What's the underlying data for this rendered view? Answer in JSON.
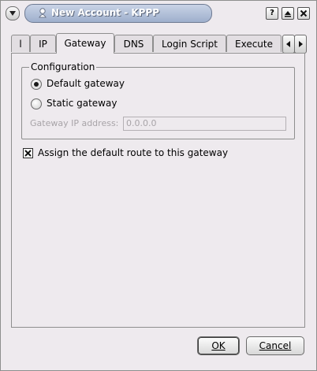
{
  "window": {
    "title": "New Account - KPPP",
    "buttons": {
      "help": "?",
      "maximize": "▲",
      "close": "✕"
    }
  },
  "tabs": [
    {
      "label": "l",
      "active": false
    },
    {
      "label": "IP",
      "active": false
    },
    {
      "label": "Gateway",
      "active": true
    },
    {
      "label": "DNS",
      "active": false
    },
    {
      "label": "Login Script",
      "active": false
    },
    {
      "label": "Execute",
      "active": false
    }
  ],
  "configuration": {
    "group_title": "Configuration",
    "default_gateway_label": "Default gateway",
    "default_gateway_selected": true,
    "static_gateway_label": "Static gateway",
    "static_gateway_selected": false,
    "ip_label": "Gateway IP address:",
    "ip_value": "0.0.0.0"
  },
  "default_route": {
    "label": "Assign the default route to this gateway",
    "checked": true
  },
  "buttons": {
    "ok_label": "OK",
    "cancel_label": "Cancel"
  },
  "colors": {
    "window_bg": "#eeeaee",
    "title_pill": "#9eafcc",
    "disabled_text": "#a8a4a8"
  }
}
